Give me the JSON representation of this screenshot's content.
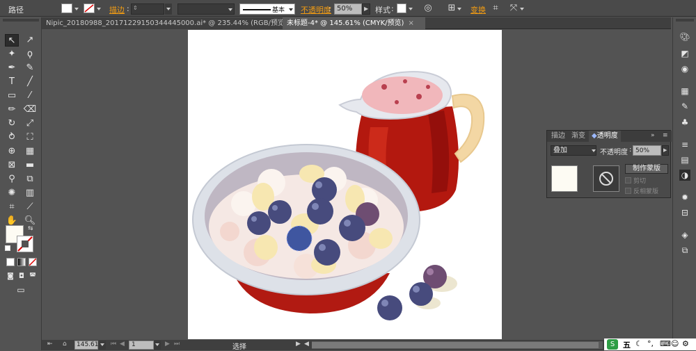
{
  "controlbar": {
    "object_type": "路径",
    "stroke_label": "描边",
    "stroke_style": "基本",
    "opacity_label": "不透明度",
    "opacity_value": "50%",
    "style_label": "样式",
    "transform_label": "变换"
  },
  "tabs": [
    {
      "label": "Nipic_20180988_20171229150344445000.ai* @ 235.44% (RGB/预览)",
      "close": "×",
      "active": false
    },
    {
      "label": "未标题-4* @ 145.61% (CMYK/预览)",
      "close": "×",
      "active": true
    }
  ],
  "transparency_panel": {
    "tabs": [
      "描边",
      "渐变",
      "透明度"
    ],
    "blend_mode": "叠加",
    "opacity_label": "不透明度",
    "opacity_value": "50%",
    "make_mask_button": "制作蒙版",
    "clip_label": "剪切",
    "invert_mask_label": "反相蒙版"
  },
  "statusbar": {
    "zoom": "145.61",
    "page": "1",
    "tool_status": "选择"
  },
  "taskbar": {
    "ime": "五"
  },
  "colors": {
    "fill": "#fdfbf3",
    "accent_orange": "#f39c12",
    "pitcher_red": "#b3180f",
    "bowl_red": "#b11a12",
    "blueberry": "#474b7d"
  }
}
